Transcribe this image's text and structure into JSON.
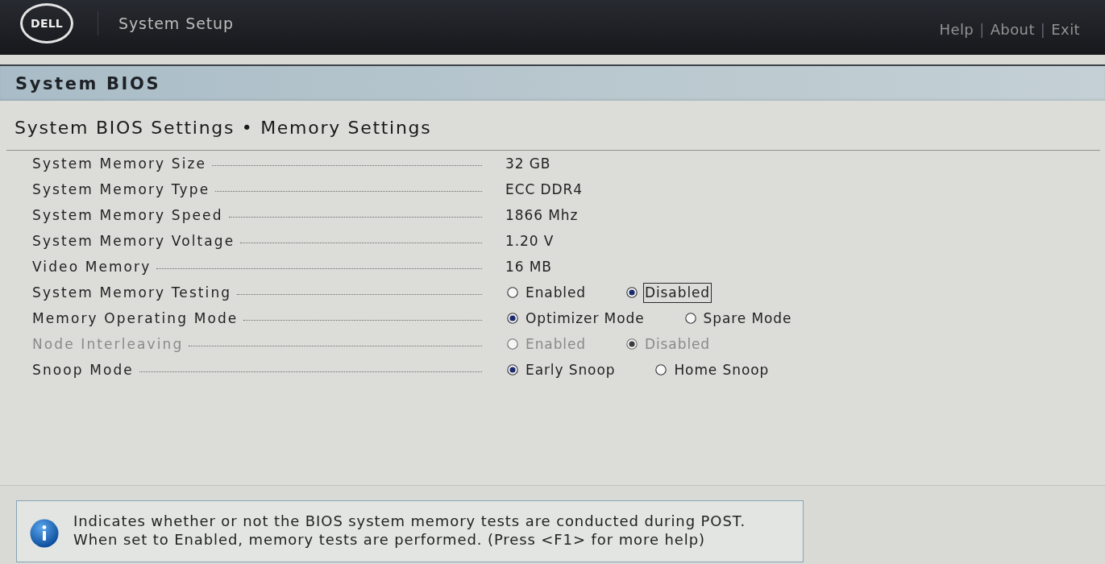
{
  "header": {
    "logo": "DELL",
    "title": "System Setup",
    "nav": [
      {
        "kind": "link",
        "text": "Help"
      },
      {
        "kind": "separator",
        "text": "|"
      },
      {
        "kind": "link",
        "text": "About"
      },
      {
        "kind": "separator",
        "text": "|"
      },
      {
        "kind": "link",
        "text": "Exit"
      }
    ]
  },
  "section_bar": {
    "title": "System BIOS"
  },
  "page": {
    "title": "System BIOS Settings • Memory Settings"
  },
  "settings": [
    {
      "label": "System Memory Size",
      "disabled": false,
      "kind": "text",
      "value": "32 GB"
    },
    {
      "label": "System Memory Type",
      "disabled": false,
      "kind": "text",
      "value": "ECC DDR4"
    },
    {
      "label": "System Memory Speed",
      "disabled": false,
      "kind": "text",
      "value": "1866 Mhz"
    },
    {
      "label": "System Memory Voltage",
      "disabled": false,
      "kind": "text",
      "value": "1.20 V"
    },
    {
      "label": "Video Memory",
      "disabled": false,
      "kind": "text",
      "value": "16 MB"
    },
    {
      "label": "System Memory Testing",
      "disabled": false,
      "kind": "radio",
      "options": [
        {
          "label": "Enabled",
          "selected": false,
          "focused": false
        },
        {
          "label": "Disabled",
          "selected": true,
          "focused": true
        }
      ]
    },
    {
      "label": "Memory Operating Mode",
      "disabled": false,
      "kind": "radio",
      "options": [
        {
          "label": "Optimizer Mode",
          "selected": true,
          "focused": false
        },
        {
          "label": "Spare Mode",
          "selected": false,
          "focused": false
        }
      ]
    },
    {
      "label": "Node Interleaving",
      "disabled": true,
      "kind": "radio",
      "options": [
        {
          "label": "Enabled",
          "selected": false,
          "focused": false
        },
        {
          "label": "Disabled",
          "selected": true,
          "focused": false
        }
      ]
    },
    {
      "label": "Snoop Mode",
      "disabled": false,
      "kind": "radio",
      "options": [
        {
          "label": "Early Snoop",
          "selected": true,
          "focused": false
        },
        {
          "label": "Home Snoop",
          "selected": false,
          "focused": false
        }
      ]
    }
  ],
  "help": {
    "text": "Indicates whether or not the BIOS system memory tests are conducted during POST.\nWhen set to Enabled, memory tests are performed. (Press <F1> for more help)"
  }
}
